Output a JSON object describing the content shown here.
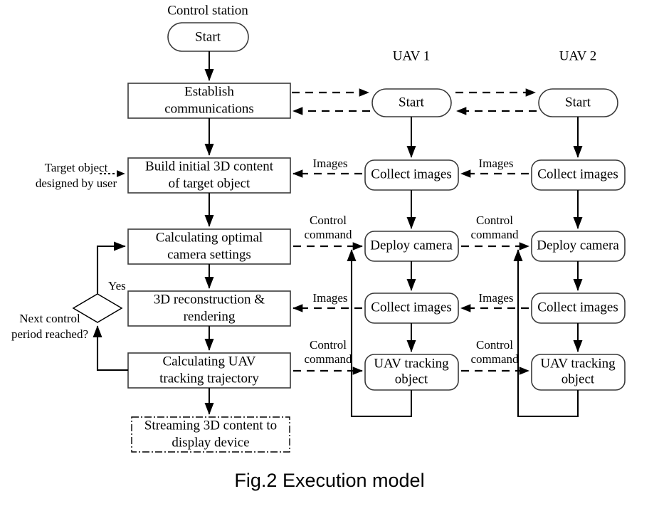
{
  "figure": {
    "caption": "Fig.2 Execution model"
  },
  "columns": [
    {
      "id": "control-station",
      "title": "Control station"
    },
    {
      "id": "uav-1",
      "title": "UAV 1"
    },
    {
      "id": "uav-2",
      "title": "UAV 2"
    }
  ],
  "control_station": {
    "nodes": [
      {
        "id": "cs-start",
        "shape": "rounded",
        "label": "Start"
      },
      {
        "id": "cs-establish",
        "shape": "rect",
        "line1": "Establish",
        "line2": "communications"
      },
      {
        "id": "cs-build",
        "shape": "rect",
        "line1": "Build initial 3D content",
        "line2": "of target object"
      },
      {
        "id": "cs-calc-camera",
        "shape": "rect",
        "line1": "Calculating optimal",
        "line2": "camera settings"
      },
      {
        "id": "cs-reconstruct",
        "shape": "rect",
        "line1": "3D reconstruction &",
        "line2": "rendering"
      },
      {
        "id": "cs-calc-traj",
        "shape": "rect",
        "line1": "Calculating UAV",
        "line2": "tracking trajectory"
      },
      {
        "id": "cs-streaming",
        "shape": "dash-dot-rect",
        "line1": "Streaming 3D content to",
        "line2": "display device"
      }
    ],
    "decision": {
      "id": "cs-decision",
      "question_line1": "Next control",
      "question_line2": "period reached?",
      "branch_label": "Yes"
    },
    "external_input": {
      "id": "target-object-input",
      "line1": "Target object",
      "line2": "designed by user"
    }
  },
  "uav_1": {
    "nodes": [
      {
        "id": "u1-start",
        "shape": "rounded",
        "label": "Start"
      },
      {
        "id": "u1-collect-1",
        "shape": "rounded",
        "label": "Collect images"
      },
      {
        "id": "u1-deploy",
        "shape": "rounded",
        "label": "Deploy camera"
      },
      {
        "id": "u1-collect-2",
        "shape": "rounded",
        "label": "Collect images"
      },
      {
        "id": "u1-track",
        "shape": "rounded",
        "line1": "UAV tracking",
        "line2": "object"
      }
    ]
  },
  "uav_2": {
    "nodes": [
      {
        "id": "u2-start",
        "shape": "rounded",
        "label": "Start"
      },
      {
        "id": "u2-collect-1",
        "shape": "rounded",
        "label": "Collect images"
      },
      {
        "id": "u2-deploy",
        "shape": "rounded",
        "label": "Deploy camera"
      },
      {
        "id": "u2-collect-2",
        "shape": "rounded",
        "label": "Collect images"
      },
      {
        "id": "u2-track",
        "shape": "rounded",
        "line1": "UAV tracking",
        "line2": "object"
      }
    ]
  },
  "edge_labels": {
    "images_cs_u1": "Images",
    "images_u1_u2": "Images",
    "control_cmd_cs_u1_deploy_l1": "Control",
    "control_cmd_cs_u1_deploy_l2": "command",
    "control_cmd_u1_u2_deploy_l1": "Control",
    "control_cmd_u1_u2_deploy_l2": "command",
    "images_cs_u1_2": "Images",
    "images_u1_u2_2": "Images",
    "control_cmd_cs_u1_track_l1": "Control",
    "control_cmd_cs_u1_track_l2": "command",
    "control_cmd_u1_u2_track_l1": "Control",
    "control_cmd_u1_u2_track_l2": "command"
  },
  "colors": {
    "stroke": "#000000",
    "box_stroke": "#3a3a3a",
    "background": "#ffffff"
  }
}
